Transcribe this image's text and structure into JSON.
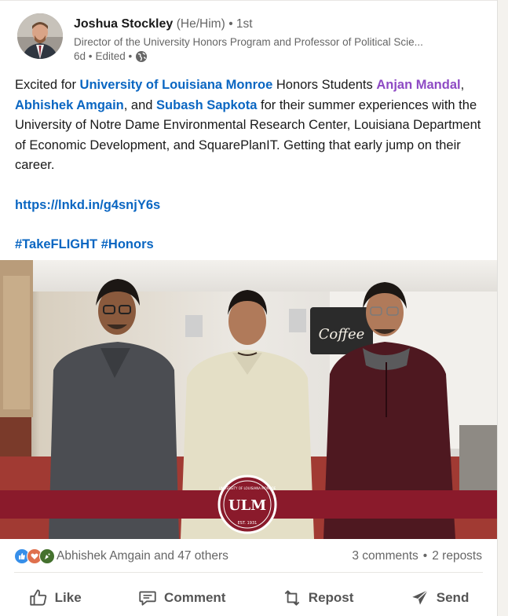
{
  "author": {
    "name": "Joshua Stockley",
    "pronouns": "(He/Him)",
    "degree": "• 1st",
    "headline": "Director of the University Honors Program and Professor of Political Scie...",
    "time": "6d •",
    "edited": "Edited •"
  },
  "post": {
    "t1": "Excited for ",
    "m1": "University of Louisiana Monroe",
    "t2": " Honors Students ",
    "m2": "Anjan Mandal",
    "t3": ", ",
    "m3": "Abhishek Amgain",
    "t4": ", and ",
    "m4": "Subash Sapkota",
    "t5": " for their summer experiences with the University of Notre Dame Environmental Research Center, Louisiana Department of Economic Development, and SquarePlanIT. Getting that early jump on their career.",
    "link": "https://lnkd.in/g4snjY6s",
    "tag1": "#TakeFLIGHT",
    "tag2": "#Honors"
  },
  "photo": {
    "logo_text": "ULM",
    "seal_top": "UNIVERSITY OF LOUISIANA MONROE",
    "seal_bottom": "EST. 1931",
    "sign_text": "Coffee"
  },
  "social": {
    "reactions": "Abhishek Amgain and 47 others",
    "comments": "3 comments",
    "sep": "•",
    "reposts": "2 reposts"
  },
  "actions": {
    "like": "Like",
    "comment": "Comment",
    "repost": "Repost",
    "send": "Send"
  },
  "colors": {
    "link_blue": "#0a66c2",
    "mention_purple": "#8e4ac4",
    "ulm_maroon": "#8a1a2b"
  }
}
